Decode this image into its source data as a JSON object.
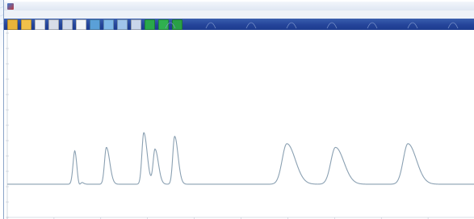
{
  "window": {
    "title": "",
    "accent_color": "#24449a"
  },
  "menu": {
    "items": [
      "",
      "",
      "",
      "",
      "",
      "",
      "",
      ""
    ]
  },
  "toolbar": {
    "buttons": [
      {
        "icon": "open-folder-icon",
        "color": "#e8b43a"
      },
      {
        "icon": "folder-icon",
        "color": "#f0c04a"
      },
      {
        "icon": "document-icon",
        "color": "#e9edf5"
      },
      {
        "icon": "print-icon",
        "color": "#d8dde8"
      },
      {
        "icon": "image-icon",
        "color": "#cfd8ea"
      },
      {
        "icon": "page-icon",
        "color": "#f2f4f8"
      },
      {
        "icon": "monitor-icon",
        "color": "#5aa0d8"
      },
      {
        "icon": "chart-icon",
        "color": "#7fb7e8"
      },
      {
        "icon": "table-icon",
        "color": "#9fc4ea"
      },
      {
        "icon": "grid-icon",
        "color": "#c9d6ea"
      },
      {
        "icon": "green-square-icon",
        "color": "#2aa84a"
      },
      {
        "icon": "green-square-icon",
        "color": "#2fb04f"
      },
      {
        "icon": "green-square-icon",
        "color": "#29a046"
      }
    ]
  },
  "chart_data": {
    "type": "line",
    "title": "",
    "xlabel": "",
    "ylabel": "",
    "grid": false,
    "line_color": "#8aa0b2",
    "peaks": [
      {
        "x": 0.145,
        "height": 0.2,
        "width": 0.004
      },
      {
        "x": 0.212,
        "height": 0.2,
        "width": 0.004
      },
      {
        "x": 0.292,
        "height": 0.28,
        "width": 0.004
      },
      {
        "x": 0.316,
        "height": 0.19,
        "width": 0.004
      },
      {
        "x": 0.358,
        "height": 0.26,
        "width": 0.004
      },
      {
        "x": 0.598,
        "height": 0.22,
        "width": 0.01
      },
      {
        "x": 0.702,
        "height": 0.2,
        "width": 0.01
      },
      {
        "x": 0.857,
        "height": 0.22,
        "width": 0.01
      }
    ],
    "dip": {
      "x": 0.152,
      "depth": 0.1,
      "width": 0.004
    },
    "baseline": 0.18
  }
}
